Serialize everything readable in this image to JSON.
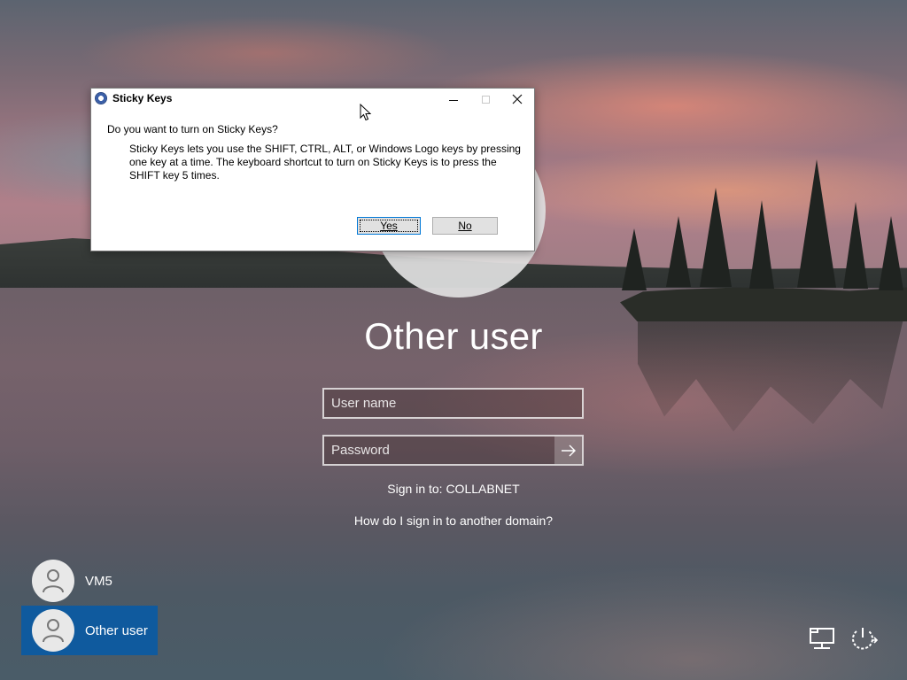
{
  "dialog": {
    "title": "Sticky Keys",
    "question": "Do you want to turn on Sticky Keys?",
    "body": "Sticky Keys lets you use the SHIFT, CTRL, ALT, or Windows Logo keys by pressing one key at a time. The keyboard shortcut to turn on Sticky Keys is to press the SHIFT key 5 times.",
    "yes_label": "Yes",
    "no_label": "No"
  },
  "signin": {
    "user_title": "Other user",
    "username_placeholder": "User name",
    "password_placeholder": "Password",
    "sign_in_to": "Sign in to: COLLABNET",
    "domain_help": "How do I sign in to another domain?"
  },
  "user_list": [
    {
      "name": "VM5",
      "selected": false
    },
    {
      "name": "Other user",
      "selected": true
    }
  ],
  "icons": {
    "network": "network-icon",
    "power": "power-icon",
    "submit": "arrow-right-icon",
    "app": "sticky-keys-icon"
  },
  "colors": {
    "selected_tile": "#0f5a9e",
    "dialog_bg": "#ffffff"
  }
}
